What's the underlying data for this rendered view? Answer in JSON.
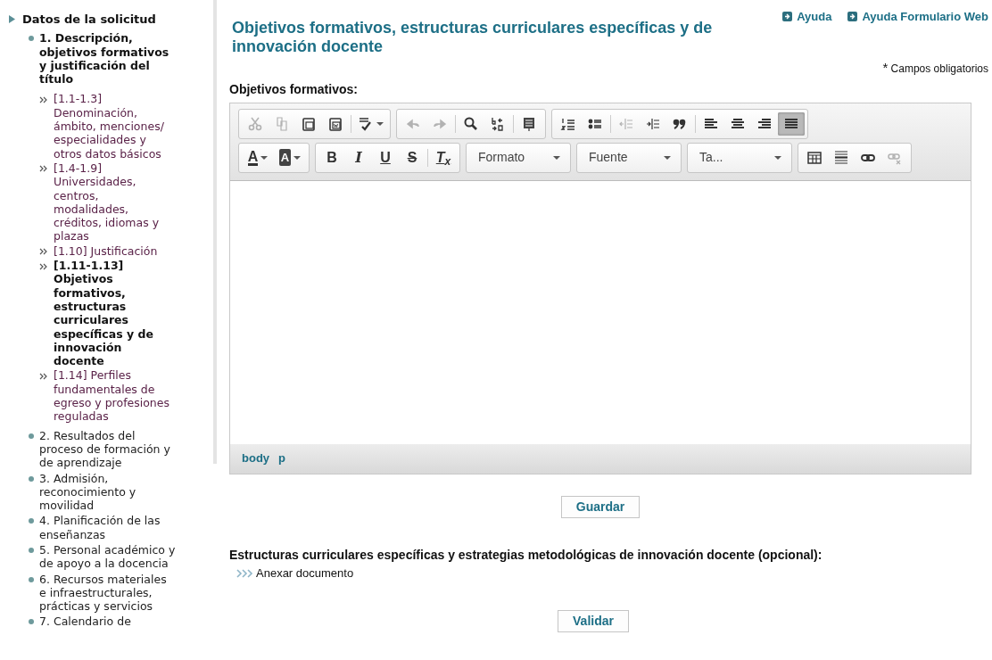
{
  "sidebar": {
    "root": {
      "label": "Datos de la solicitud",
      "expanded": true,
      "children": [
        {
          "label": "1. Descripción, objetivos formativos y justificación del título",
          "selected": true,
          "children": [
            {
              "label": "[1.1-1.3] Denominación, ámbito, menciones/ especialidades y otros datos básicos",
              "selected": false
            },
            {
              "label": "[1.4-1.9] Universidades, centros, modalidades, créditos, idiomas y plazas",
              "selected": false
            },
            {
              "label": "[1.10] Justificación",
              "selected": false
            },
            {
              "label": "[1.11-1.13] Objetivos formativos, estructuras curriculares específicas y de innovación docente",
              "selected": true
            },
            {
              "label": "[1.14] Perfiles fundamentales de egreso y profesiones reguladas",
              "selected": false
            }
          ]
        },
        {
          "label": "2. Resultados del proceso de formación y de aprendizaje",
          "selected": false
        },
        {
          "label": "3. Admisión, reconocimiento y movilidad",
          "selected": false
        },
        {
          "label": "4. Planificación de las enseñanzas",
          "selected": false
        },
        {
          "label": "5. Personal académico y de apoyo a la docencia",
          "selected": false
        },
        {
          "label": "6. Recursos materiales e infraestructurales, prácticas y servicios",
          "selected": false
        },
        {
          "label": "7. Calendario de",
          "selected": false
        }
      ]
    }
  },
  "page": {
    "title": "Objetivos formativos, estructuras curriculares específicas y de innovación docente",
    "help_links": [
      "Ayuda",
      "Ayuda Formulario Web"
    ],
    "required_mark": "*",
    "required_note": "Campos obligatorios",
    "field_label": "Objetivos formativos:",
    "editor": {
      "toolbar_rows": [
        [
          [
            {
              "kind": "cut",
              "disabled": true
            },
            {
              "kind": "copy",
              "disabled": true
            },
            {
              "kind": "paste",
              "disabled": false
            },
            {
              "kind": "paste-word",
              "disabled": false
            },
            {
              "kind": "spellcheck",
              "disabled": false
            }
          ],
          [
            {
              "kind": "undo",
              "disabled": true
            },
            {
              "kind": "redo",
              "disabled": true
            },
            {
              "kind": "search",
              "disabled": false
            },
            {
              "kind": "replace",
              "disabled": false
            },
            {
              "kind": "select-all",
              "disabled": false
            }
          ],
          [
            {
              "kind": "ordered-list",
              "disabled": false
            },
            {
              "kind": "bullet-list",
              "disabled": false
            },
            {
              "kind": "outdent",
              "disabled": true
            },
            {
              "kind": "indent",
              "disabled": false
            },
            {
              "kind": "quote",
              "disabled": false
            },
            {
              "kind": "align-left",
              "disabled": false
            },
            {
              "kind": "align-center",
              "disabled": false
            },
            {
              "kind": "align-right",
              "disabled": false
            },
            {
              "kind": "justify",
              "disabled": false,
              "selected": true
            }
          ]
        ],
        [
          [
            {
              "kind": "text-color",
              "label": "A",
              "disabled": false
            },
            {
              "kind": "bg-color",
              "label": "A",
              "disabled": false
            }
          ],
          [
            {
              "kind": "bold",
              "label": "B",
              "disabled": false
            },
            {
              "kind": "italic",
              "label": "I",
              "disabled": false
            },
            {
              "kind": "underline",
              "label": "U",
              "disabled": false
            },
            {
              "kind": "strike",
              "label": "S",
              "disabled": false
            },
            {
              "kind": "clear-format",
              "label": "T$_{x}$",
              "disabled": false
            }
          ],
          [
            {
              "kind": "combo",
              "label": "Formato"
            }
          ],
          [
            {
              "kind": "combo",
              "label": "Fuente"
            }
          ],
          [
            {
              "kind": "combo",
              "label": "Ta..."
            }
          ],
          [
            {
              "kind": "table",
              "disabled": false
            },
            {
              "kind": "rule",
              "disabled": false
            },
            {
              "kind": "link",
              "disabled": false
            },
            {
              "kind": "unlink",
              "disabled": true
            }
          ]
        ]
      ],
      "path": [
        "body",
        "p"
      ]
    },
    "save_button": "Guardar",
    "section_label": "Estructuras curriculares específicas y estrategias metodológicas de innovación docente (opcional):",
    "attach_link": "Anexar documento",
    "validate_button": "Validar"
  }
}
